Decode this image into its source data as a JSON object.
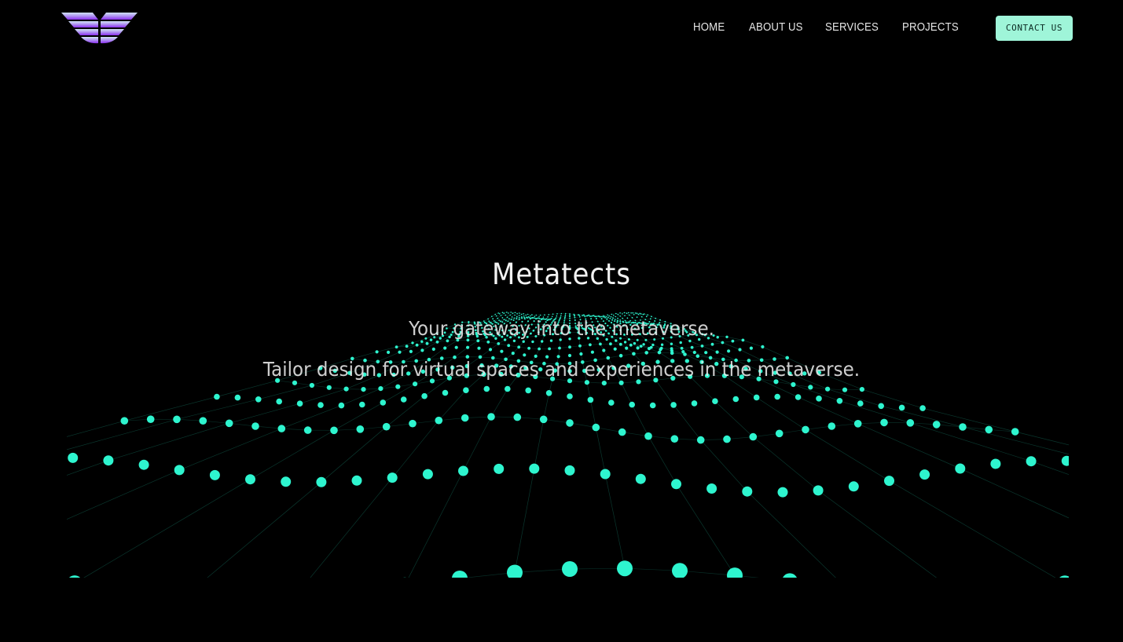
{
  "header": {
    "logo_icon": "winged-logo-icon",
    "nav": {
      "home": "HOME",
      "about": "ABOUT US",
      "services": "SERVICES",
      "projects": "PROJECTS"
    },
    "contact_label": "CONTACT US"
  },
  "hero": {
    "title": "Metatects",
    "tagline": "Your gateway into the metaverse.",
    "subtitle": "Tailor design for virtual spaces and experiences in the metaverse.",
    "background": "particle-wave-grid"
  },
  "colors": {
    "background": "#000000",
    "accent": "#2ef5cf",
    "button_bg": "#9ff5d9",
    "logo_top": "#c9d9f7",
    "logo_bottom": "#8a3ff0"
  }
}
